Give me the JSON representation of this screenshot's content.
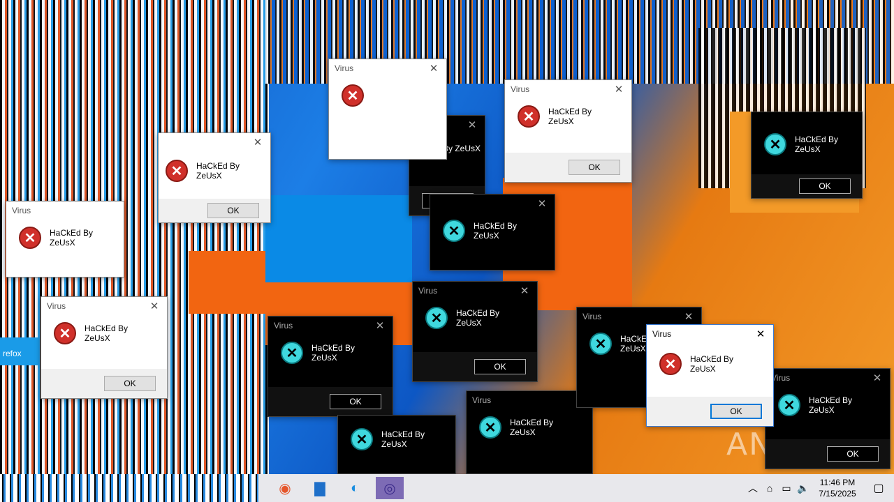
{
  "dialog": {
    "title": "Virus",
    "message": "HaCkEd By ZeUsX",
    "ok_label": "OK",
    "close_glyph": "✕"
  },
  "icons": {
    "error_light": "error-icon",
    "error_dark": "error-icon-cyan"
  },
  "desktop": {
    "side_label": "refox",
    "watermark": "ANY▷RUN"
  },
  "taskbar": {
    "apps": [
      "edge-icon",
      "file-explorer-icon",
      "firefox-icon",
      "app-icon"
    ],
    "time": "11:46 PM",
    "date": "7/15/2025"
  },
  "colors": {
    "error_red": "#d0302a",
    "error_cyan": "#3fd8de",
    "wallpaper_blue": "#0a57c8",
    "wallpaper_orange": "#f26511"
  }
}
